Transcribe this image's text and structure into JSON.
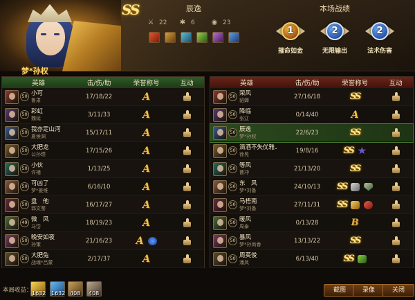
{
  "header": {
    "subject_rank": "SS",
    "player_name": "辰逸",
    "stats": [
      {
        "icon": "crossed-swords-icon",
        "value": "22"
      },
      {
        "icon": "skull-icon",
        "value": "6"
      },
      {
        "icon": "assist-icon",
        "value": "23"
      }
    ],
    "items": [
      "item-a",
      "item-b",
      "item-c",
      "item-d",
      "item-e",
      "item-f"
    ],
    "honors_title": "本场战绩",
    "honors": [
      {
        "number": "1",
        "label": "摧命如金",
        "color": "gold"
      },
      {
        "number": "2",
        "label": "无限输出",
        "color": "blue"
      },
      {
        "number": "2",
        "label": "法术伤害",
        "color": "blue"
      }
    ],
    "subject_name": "梦*孙权"
  },
  "table_headers": {
    "hero": "英雄",
    "kda": "击/伤/助",
    "honor": "荣誉称号",
    "interact": "互动"
  },
  "left_team": [
    {
      "hero": "小可",
      "player": "鲁肃",
      "level": "50",
      "kda": "17/18/22",
      "honors": [
        "A"
      ]
    },
    {
      "hero": "彩虹",
      "player": "魏延",
      "level": "50",
      "kda": "3/11/33",
      "honors": [
        "A"
      ]
    },
    {
      "hero": "我亦定山河",
      "player": "夏侯渊",
      "level": "50",
      "kda": "15/17/11",
      "honors": [
        "A"
      ]
    },
    {
      "hero": "大肥龙",
      "player": "公孙瓒",
      "level": "50",
      "kda": "17/15/26",
      "honors": [
        "A"
      ]
    },
    {
      "hero": "小伙",
      "player": "许褚",
      "level": "50",
      "kda": "1/13/25",
      "honors": [
        "A"
      ]
    },
    {
      "hero": "可凶了",
      "player": "梦*姜维",
      "level": "50",
      "kda": "6/16/10",
      "honors": [
        "A"
      ]
    },
    {
      "hero": "盘　他",
      "player": "郭文蜀",
      "level": "50",
      "kda": "16/17/27",
      "honors": [
        "A"
      ]
    },
    {
      "hero": "微　风",
      "player": "马岱",
      "level": "49",
      "kda": "18/19/23",
      "honors": [
        "A"
      ]
    },
    {
      "hero": "晚安如夜",
      "player": "孙策",
      "level": "50",
      "kda": "21/16/23",
      "honors": [
        "A",
        "blue"
      ]
    },
    {
      "hero": "大肥兔",
      "player": "战魂*吕蒙",
      "level": "50",
      "kda": "2/17/37",
      "honors": [
        "A"
      ]
    }
  ],
  "right_team": [
    {
      "hero": "荣风",
      "player": "貂蝉",
      "level": "50",
      "kda": "27/16/18",
      "honors": [
        "S"
      ]
    },
    {
      "hero": "降临",
      "player": "张辽",
      "level": "50",
      "kda": "0/14/40",
      "honors": [
        "A"
      ]
    },
    {
      "hero": "辰逸",
      "player": "梦*孙权",
      "level": "50",
      "kda": "22/6/23",
      "honors": [
        "S"
      ],
      "highlight": true
    },
    {
      "hero": "滴酒不失优雅．",
      "player": "徐晃",
      "level": "50",
      "kda": "19/8/16",
      "honors": [
        "S",
        "star"
      ]
    },
    {
      "hero": "等风",
      "player": "曹冲",
      "level": "50",
      "kda": "21/13/20",
      "honors": [
        "S"
      ]
    },
    {
      "hero": "东　风",
      "player": "梦*刘备",
      "level": "50",
      "kda": "24/10/13",
      "honors": [
        "S",
        "silver",
        "shield"
      ]
    },
    {
      "hero": "马梧南",
      "player": "梦*刘备",
      "level": "50",
      "kda": "27/11/31",
      "honors": [
        "S",
        "gold",
        "red"
      ]
    },
    {
      "hero": "暖风",
      "player": "周泰",
      "level": "50",
      "kda": "0/13/28",
      "honors": [
        "B"
      ]
    },
    {
      "hero": "暴风",
      "player": "梦*孙尚香",
      "level": "50",
      "kda": "13/13/22",
      "honors": [
        "S"
      ]
    },
    {
      "hero": "周英俊",
      "player": "潘凤",
      "level": "50",
      "kda": "6/13/40",
      "honors": [
        "S",
        "green"
      ]
    }
  ],
  "footer": {
    "income_label": "本局收益：",
    "resources": [
      "1632",
      "1632",
      "408",
      "408"
    ],
    "buttons": [
      "截图",
      "录像",
      "关闭"
    ]
  }
}
